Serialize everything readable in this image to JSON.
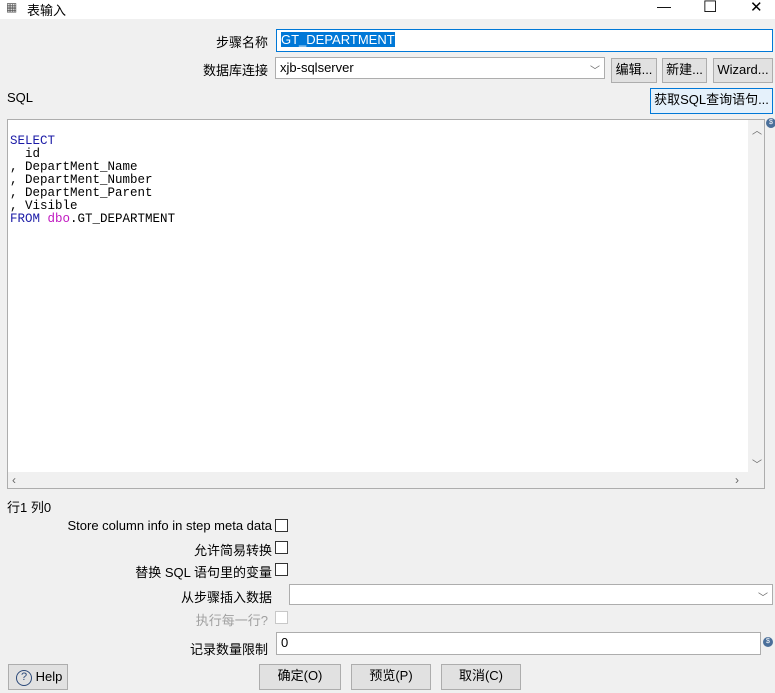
{
  "window": {
    "title": "表输入",
    "minimize": "—",
    "maximize": "☐",
    "close": "✕"
  },
  "step_name": {
    "label": "步骤名称",
    "value": "GT_DEPARTMENT"
  },
  "db_connection": {
    "label": "数据库连接",
    "value": "xjb-sqlserver",
    "edit": "编辑...",
    "new": "新建...",
    "wizard": "Wizard..."
  },
  "sql": {
    "label": "SQL",
    "get_query_button": "获取SQL查询语句...",
    "lines": [
      {
        "kw": "SELECT"
      },
      {
        "text": "  id"
      },
      {
        "text": ", DepartMent_Name"
      },
      {
        "text": ", DepartMent_Number"
      },
      {
        "text": ", DepartMent_Parent"
      },
      {
        "text": ", Visible"
      },
      {
        "kw": "FROM",
        "schema": "dbo",
        "table": ".GT_DEPARTMENT"
      }
    ]
  },
  "cursor_pos": "行1 列0",
  "options": {
    "store_column_info": "Store column info in step meta data",
    "lazy_conversion": "允许简易转换",
    "replace_variables": "替换 SQL 语句里的变量",
    "insert_from_step": "从步骤插入数据",
    "insert_from_step_value": "",
    "execute_each_row": "执行每一行?",
    "limit_label": "记录数量限制",
    "limit_value": "0"
  },
  "buttons": {
    "help": "Help",
    "ok": "确定(O)",
    "preview": "预览(P)",
    "cancel": "取消(C)"
  }
}
